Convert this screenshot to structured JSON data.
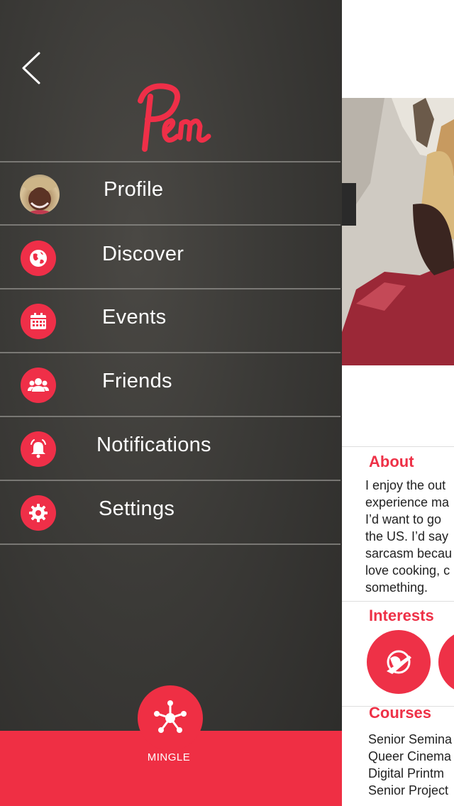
{
  "menu": {
    "back_icon": "chevron-left-icon",
    "logo_text": "Pen",
    "items": [
      {
        "label": "Profile",
        "icon": "avatar-photo"
      },
      {
        "label": "Discover",
        "icon": "globe-icon"
      },
      {
        "label": "Events",
        "icon": "calendar-icon"
      },
      {
        "label": "Friends",
        "icon": "users-icon"
      },
      {
        "label": "Notifications",
        "icon": "bell-icon"
      },
      {
        "label": "Settings",
        "icon": "gear-icon"
      }
    ]
  },
  "bottom_bar": {
    "mingle_label": "MINGLE",
    "mingle_icon": "network-icon"
  },
  "profile_peek": {
    "about_title": "About",
    "about_lines": [
      "I enjoy the out",
      "experience ma",
      "I’d want to go",
      "the US. I’d say",
      "sarcasm becau",
      "love cooking, c",
      "something."
    ],
    "interests_title": "Interests",
    "courses_title": "Courses",
    "courses": [
      "Senior Semina",
      "Queer Cinema",
      "Digital Printm",
      "Senior Project"
    ]
  },
  "colors": {
    "accent": "#ef2f48",
    "drawer_bg": "#3b3a37",
    "divider": "#8f8e8a",
    "text_light": "#ffffff"
  }
}
